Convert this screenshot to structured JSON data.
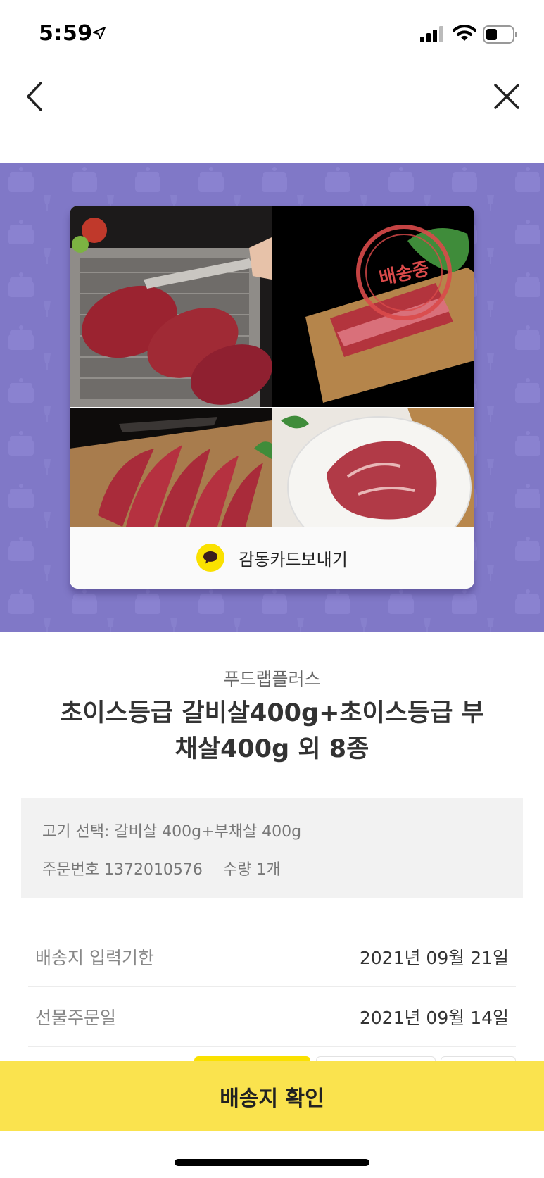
{
  "status_bar": {
    "time": "5:59",
    "icons": [
      "location-arrow-icon",
      "cellular-signal-icon",
      "wifi-icon",
      "battery-icon"
    ]
  },
  "nav": {
    "icons": [
      "chevron-left-icon",
      "close-icon"
    ]
  },
  "hero": {
    "background_color": "#8078c7",
    "stamp_text": "배송중",
    "card_action_label": "감동카드보내기",
    "card_action_icon": "speech-bubble-icon"
  },
  "product": {
    "brand": "푸드랩플러스",
    "title_line1": "초이스등급 갈비살400g+초이스등급 부",
    "title_line2": "채살400g 외 8종"
  },
  "order": {
    "option_text": "고기 선택: 갈비살 400g+부채살 400g",
    "order_number_label": "주문번호 1372010576",
    "quantity_label": "수량 1개"
  },
  "info_rows": [
    {
      "label": "배송지 입력기한",
      "value": "2021년 09월 21일"
    },
    {
      "label": "선물주문일",
      "value": "2021년 09월 14일"
    }
  ],
  "cta": {
    "label": "배송지 확인",
    "color": "#fae34e"
  }
}
